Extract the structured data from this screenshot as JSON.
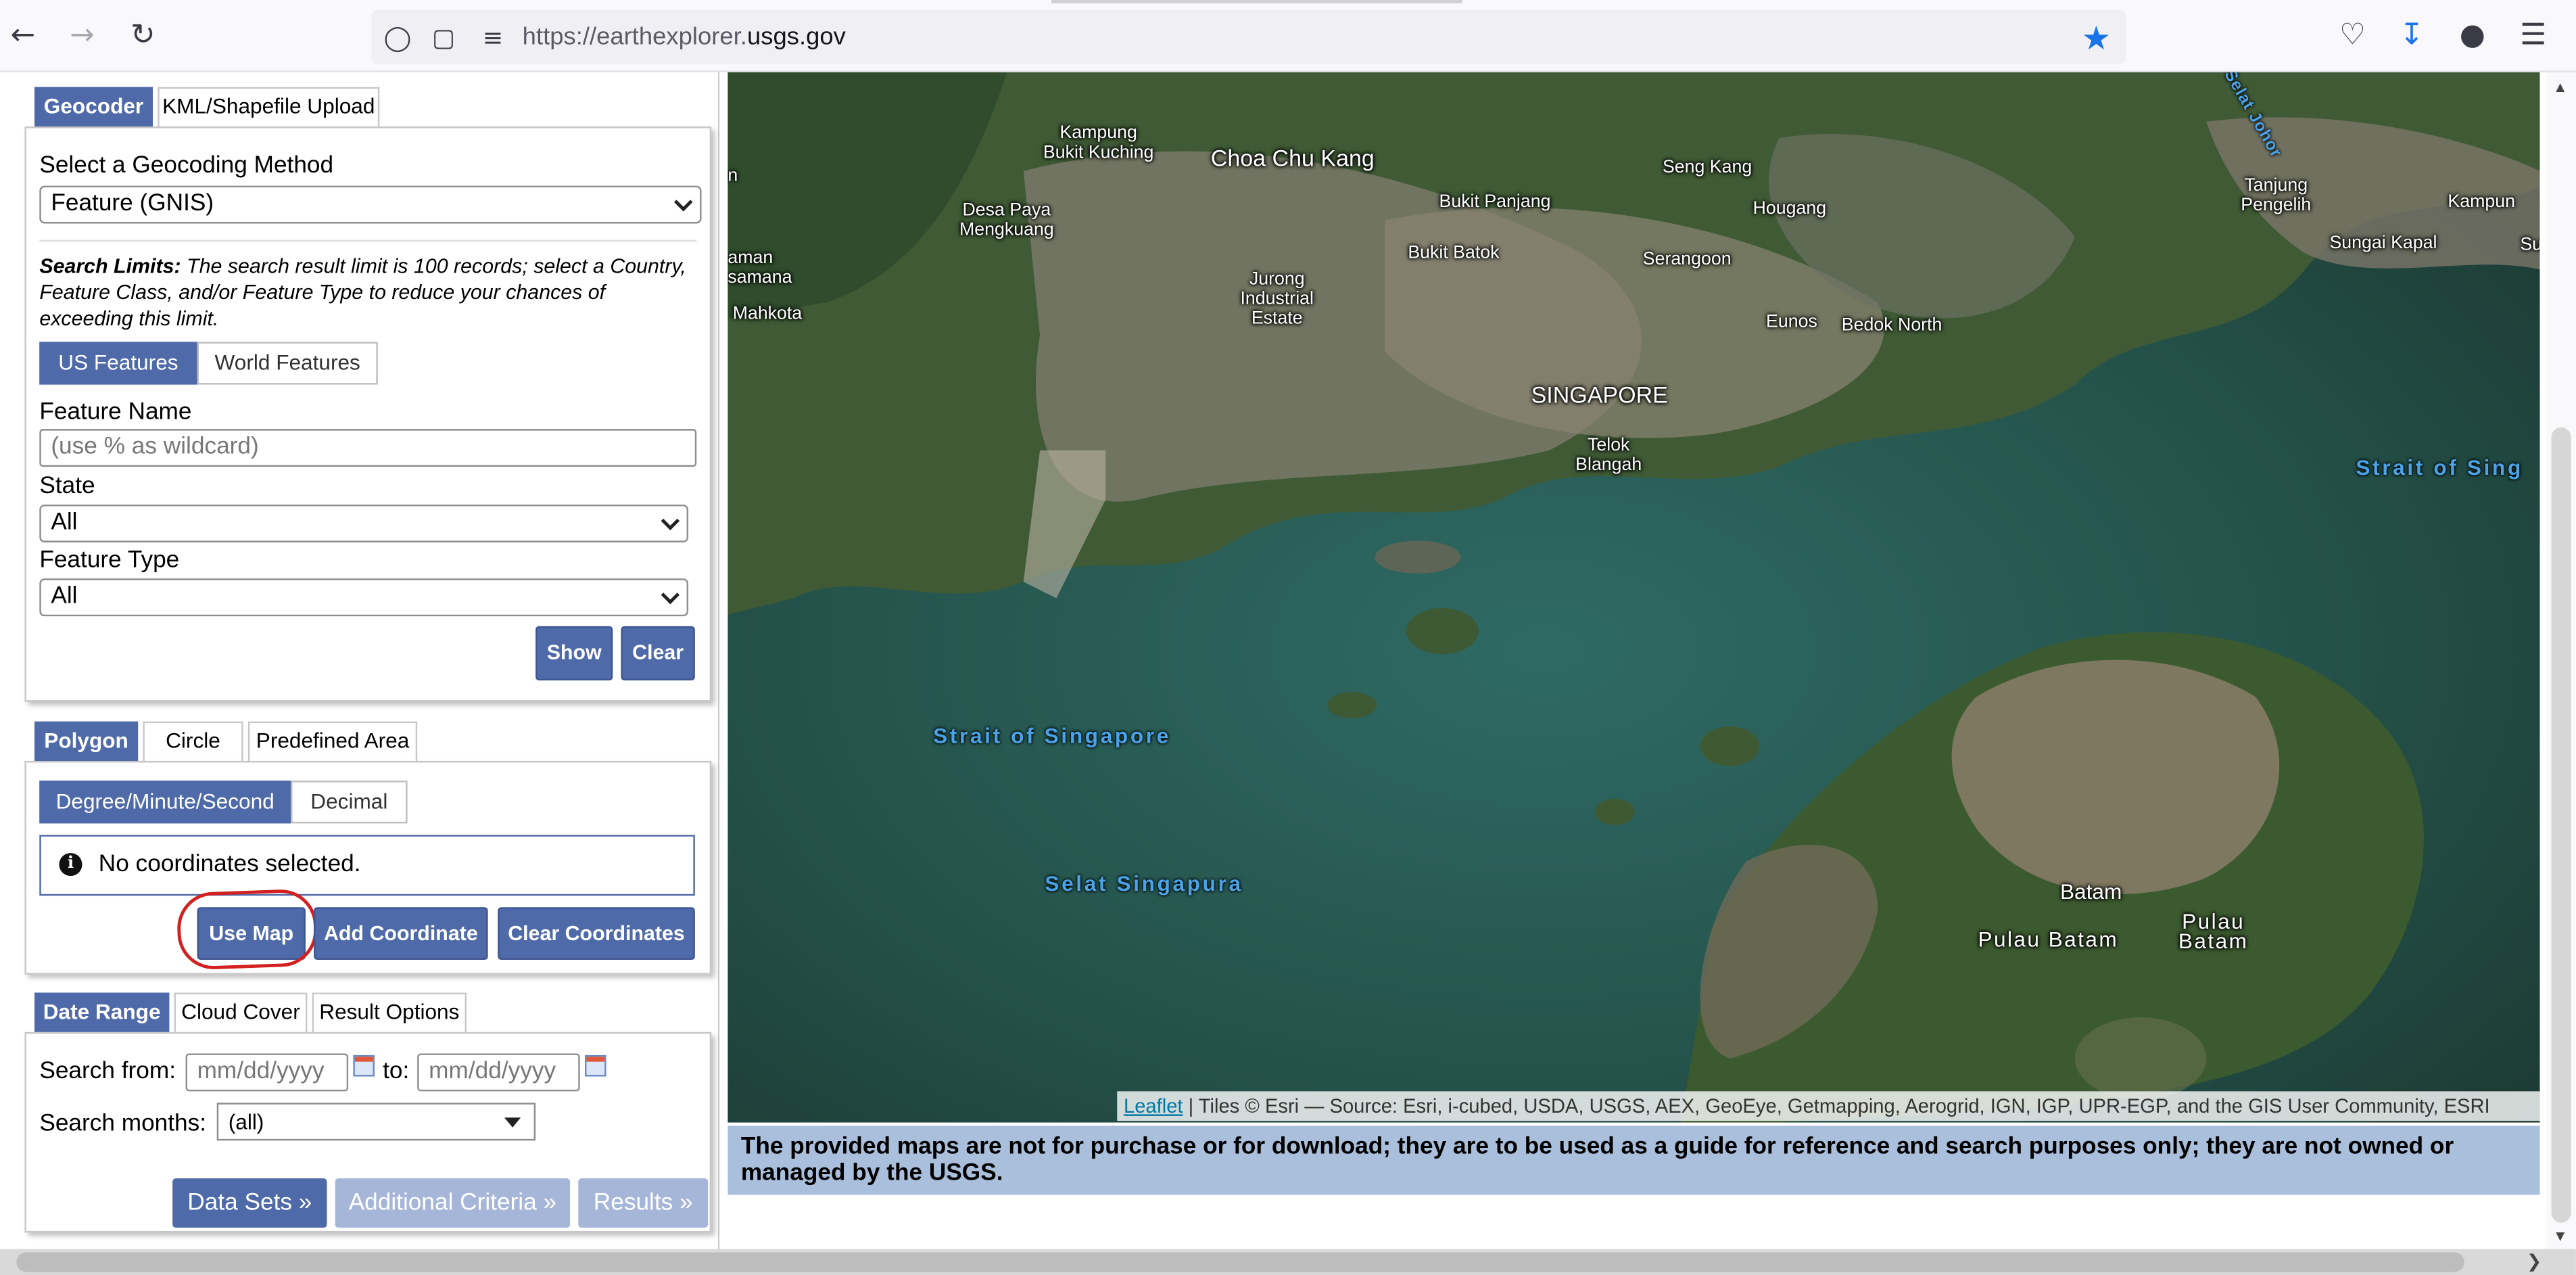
{
  "browser": {
    "url_prefix": "https://earthexplorer.",
    "url_domain": "usgs.gov"
  },
  "geocoder": {
    "tabs": [
      "Geocoder",
      "KML/Shapefile Upload"
    ],
    "method_label": "Select a Geocoding Method",
    "method_value": "Feature (GNIS)",
    "limits_bold": "Search Limits:",
    "limits_text": " The search result limit is 100 records; select a Country, Feature Class, and/or Feature Type to reduce your chances of exceeding this limit.",
    "feature_toggle": [
      "US Features",
      "World Features"
    ],
    "feature_name_label": "Feature Name",
    "feature_name_placeholder": "(use % as wildcard)",
    "state_label": "State",
    "state_value": "All",
    "feature_type_label": "Feature Type",
    "feature_type_value": "All",
    "show_button": "Show",
    "clear_button": "Clear"
  },
  "area": {
    "tabs": [
      "Polygon",
      "Circle",
      "Predefined Area"
    ],
    "format_toggle": [
      "Degree/Minute/Second",
      "Decimal"
    ],
    "info_text": "No coordinates selected.",
    "use_map_button": "Use Map",
    "add_coordinate_button": "Add Coordinate",
    "clear_coordinates_button": "Clear Coordinates"
  },
  "date": {
    "tabs": [
      "Date Range",
      "Cloud Cover",
      "Result Options"
    ],
    "search_from_label": "Search from:",
    "from_placeholder": "mm/dd/yyyy",
    "to_label": "to:",
    "to_placeholder": "mm/dd/yyyy",
    "months_label": "Search months:",
    "months_value": "(all)"
  },
  "nav": {
    "data_sets": "Data Sets »",
    "additional_criteria": "Additional Criteria »",
    "results": "Results »"
  },
  "map": {
    "labels": [
      "Kampung\nBukit Kuching",
      "Choa Chu Kang",
      "Seng Kang",
      "Desa Paya\nMengkuang",
      "Bukit Panjang",
      "Hougang",
      "Tanjung\nPengelih",
      "Kampun",
      "aman\nsamana",
      "Bukit Batok",
      "Serangoon",
      "Sungai Kapal",
      "Su",
      "Jurong\nIndustrial\nEstate",
      "Mahkota",
      "Eunos",
      "Bedok North",
      "SINGAPORE",
      "Telok\nBlangah",
      "Batam",
      "Pulau\nBatam",
      "Pulau Batam",
      "n"
    ],
    "water_labels": [
      "Strait of Singapore",
      "Selat Singapura",
      "Strait of Sing",
      "Selat Johor"
    ],
    "attribution_link": "Leaflet",
    "attribution_text": " | Tiles © Esri — Source: Esri, i-cubed, USDA, USGS, AEX, GeoEye, Getmapping, Aerogrid, IGN, IGP, UPR-EGP, and the GIS User Community, ESRI",
    "disclaimer": "The provided maps are not for purchase or for download; they are to be used as a guide for reference and search purposes only; they are not owned or managed by the USGS."
  },
  "colors": {
    "accent": "#4f6aa8",
    "annotation": "#d32020",
    "disclaimer_bg": "#a9bfdb"
  }
}
